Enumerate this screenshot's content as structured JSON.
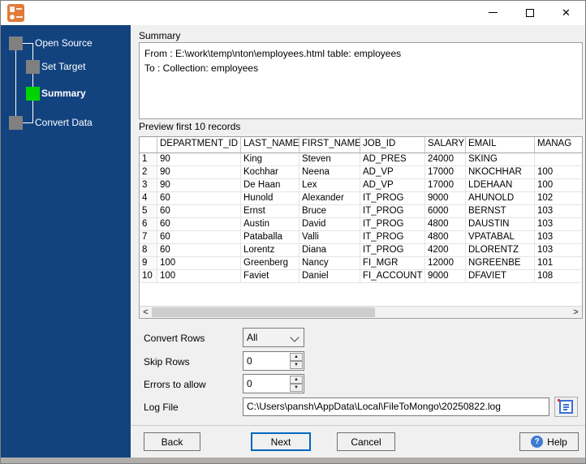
{
  "colors": {
    "sidebar_bg": "#12437f",
    "active_step": "#00d400",
    "inactive_step": "#808080",
    "focus_border": "#0067c0",
    "help_icon_blue": "#3f7ad2",
    "app_icon_orange": "#e07b39"
  },
  "sidebar": {
    "steps": [
      {
        "label": "Open Source",
        "state": "done"
      },
      {
        "label": "Set Target",
        "state": "done"
      },
      {
        "label": "Summary",
        "state": "active"
      },
      {
        "label": "Convert Data",
        "state": "pending"
      }
    ]
  },
  "summary": {
    "label": "Summary",
    "lines": [
      "From : E:\\work\\temp\\nton\\employees.html table: employees",
      "To : Collection: employees"
    ]
  },
  "preview": {
    "label": "Preview first 10 records",
    "columns": [
      "",
      "DEPARTMENT_ID",
      "LAST_NAME",
      "FIRST_NAME",
      "JOB_ID",
      "SALARY",
      "EMAIL",
      "MANAG"
    ],
    "rows": [
      [
        "1",
        "90",
        "King",
        "Steven",
        "AD_PRES",
        "24000",
        "SKING",
        ""
      ],
      [
        "2",
        "90",
        "Kochhar",
        "Neena",
        "AD_VP",
        "17000",
        "NKOCHHAR",
        "100"
      ],
      [
        "3",
        "90",
        "De Haan",
        "Lex",
        "AD_VP",
        "17000",
        "LDEHAAN",
        "100"
      ],
      [
        "4",
        "60",
        "Hunold",
        "Alexander",
        "IT_PROG",
        "9000",
        "AHUNOLD",
        "102"
      ],
      [
        "5",
        "60",
        "Ernst",
        "Bruce",
        "IT_PROG",
        "6000",
        "BERNST",
        "103"
      ],
      [
        "6",
        "60",
        "Austin",
        "David",
        "IT_PROG",
        "4800",
        "DAUSTIN",
        "103"
      ],
      [
        "7",
        "60",
        "Pataballa",
        "Valli",
        "IT_PROG",
        "4800",
        "VPATABAL",
        "103"
      ],
      [
        "8",
        "60",
        "Lorentz",
        "Diana",
        "IT_PROG",
        "4200",
        "DLORENTZ",
        "103"
      ],
      [
        "9",
        "100",
        "Greenberg",
        "Nancy",
        "FI_MGR",
        "12000",
        "NGREENBE",
        "101"
      ],
      [
        "10",
        "100",
        "Faviet",
        "Daniel",
        "FI_ACCOUNT",
        "9000",
        "DFAVIET",
        "108"
      ]
    ]
  },
  "options": {
    "convert_rows": {
      "label": "Convert Rows",
      "value": "All"
    },
    "skip_rows": {
      "label": "Skip Rows",
      "value": "0"
    },
    "errors_to_allow": {
      "label": "Errors to allow",
      "value": "0"
    },
    "log_file": {
      "label": "Log File",
      "value": "C:\\Users\\pansh\\AppData\\Local\\FileToMongo\\20250822.log"
    }
  },
  "buttons": {
    "back": "Back",
    "next": "Next",
    "cancel": "Cancel",
    "help": "Help"
  }
}
